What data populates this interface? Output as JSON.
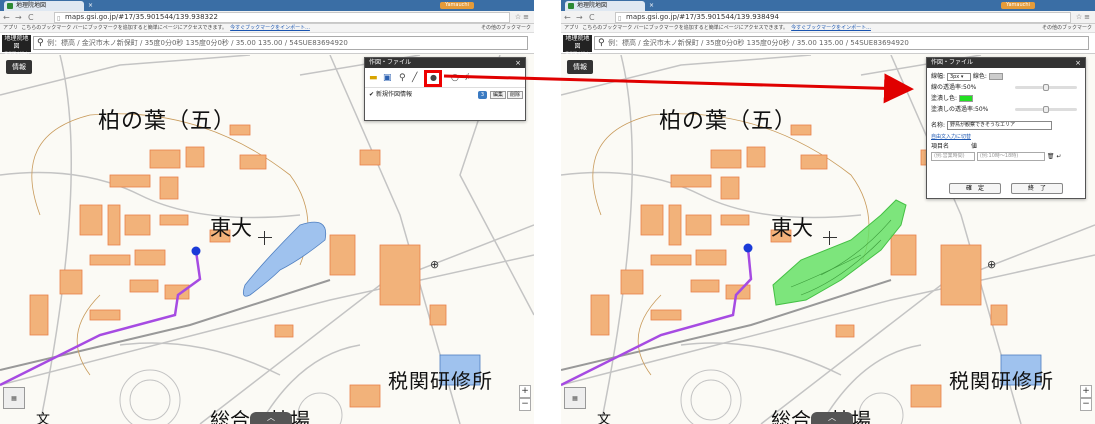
{
  "left": {
    "tab_title": "地理院地図",
    "url": "maps.gsi.go.jp/#17/35.901544/139.938322",
    "search_text": "例：標高 / 金沢市木ノ新保町 / 35度0分0秒 135度0分0秒 / 35.00 135.00 / 54SUE83694920",
    "panel_title": "作図・ファイル",
    "layer_name": "新規作図情報",
    "layer_count": "3",
    "edit_label": "編集",
    "delete_label": "削除"
  },
  "right": {
    "tab_title": "地理院地図",
    "url": "maps.gsi.go.jp/#17/35.901544/139.938494",
    "search_text": "例：標高 / 金沢市木ノ新保町 / 35度0分0秒 135度0分0秒 / 35.00 135.00 / 54SUE83694920",
    "panel_title": "作図・ファイル",
    "line_width_label": "線幅:",
    "line_width_value": "3px",
    "line_color_label": "線色:",
    "line_opacity_label": "線の透過率:50%",
    "fill_color_label": "塗潰し色:",
    "fill_opacity_label": "塗潰しの透過率:50%",
    "name_label": "名称:",
    "name_value": "野鳥が観察できそうなエリア",
    "freeform_link": "自由文入力に切替",
    "key_label": "項目名",
    "value_label": "値",
    "key_placeholder": "(例:営業時間)",
    "value_placeholder": "(例:10時〜18時)",
    "confirm_label": "確　定",
    "finish_label": "終　了"
  },
  "browser": {
    "apps_label": "アプリ",
    "bookmark_hint": "こちらのブックマーク バーにブックマークを追加すると簡単にページにアクセスできます。",
    "bookmark_import": "今すぐブックマークをインポート...",
    "other_bookmarks": "その他のブックマーク",
    "user_badge": "Yamauchi",
    "gsi_logo": "地理院地図",
    "gsi_logo_sub": "電子国土Web",
    "info_label": "情報"
  },
  "map_labels": {
    "kashiwa": "柏の葉（五）",
    "todai": "東大",
    "zeikan": "税関研修所",
    "sogo": "総合　技場",
    "x_mark": "文"
  },
  "colors": {
    "building": "#f2b27a",
    "building_stroke": "#e8804a",
    "road": "#b9b9b9",
    "route": "#8a2be2",
    "water": "#7faee8",
    "polygon_fill": "#66e066",
    "arrow": "#e00000"
  }
}
